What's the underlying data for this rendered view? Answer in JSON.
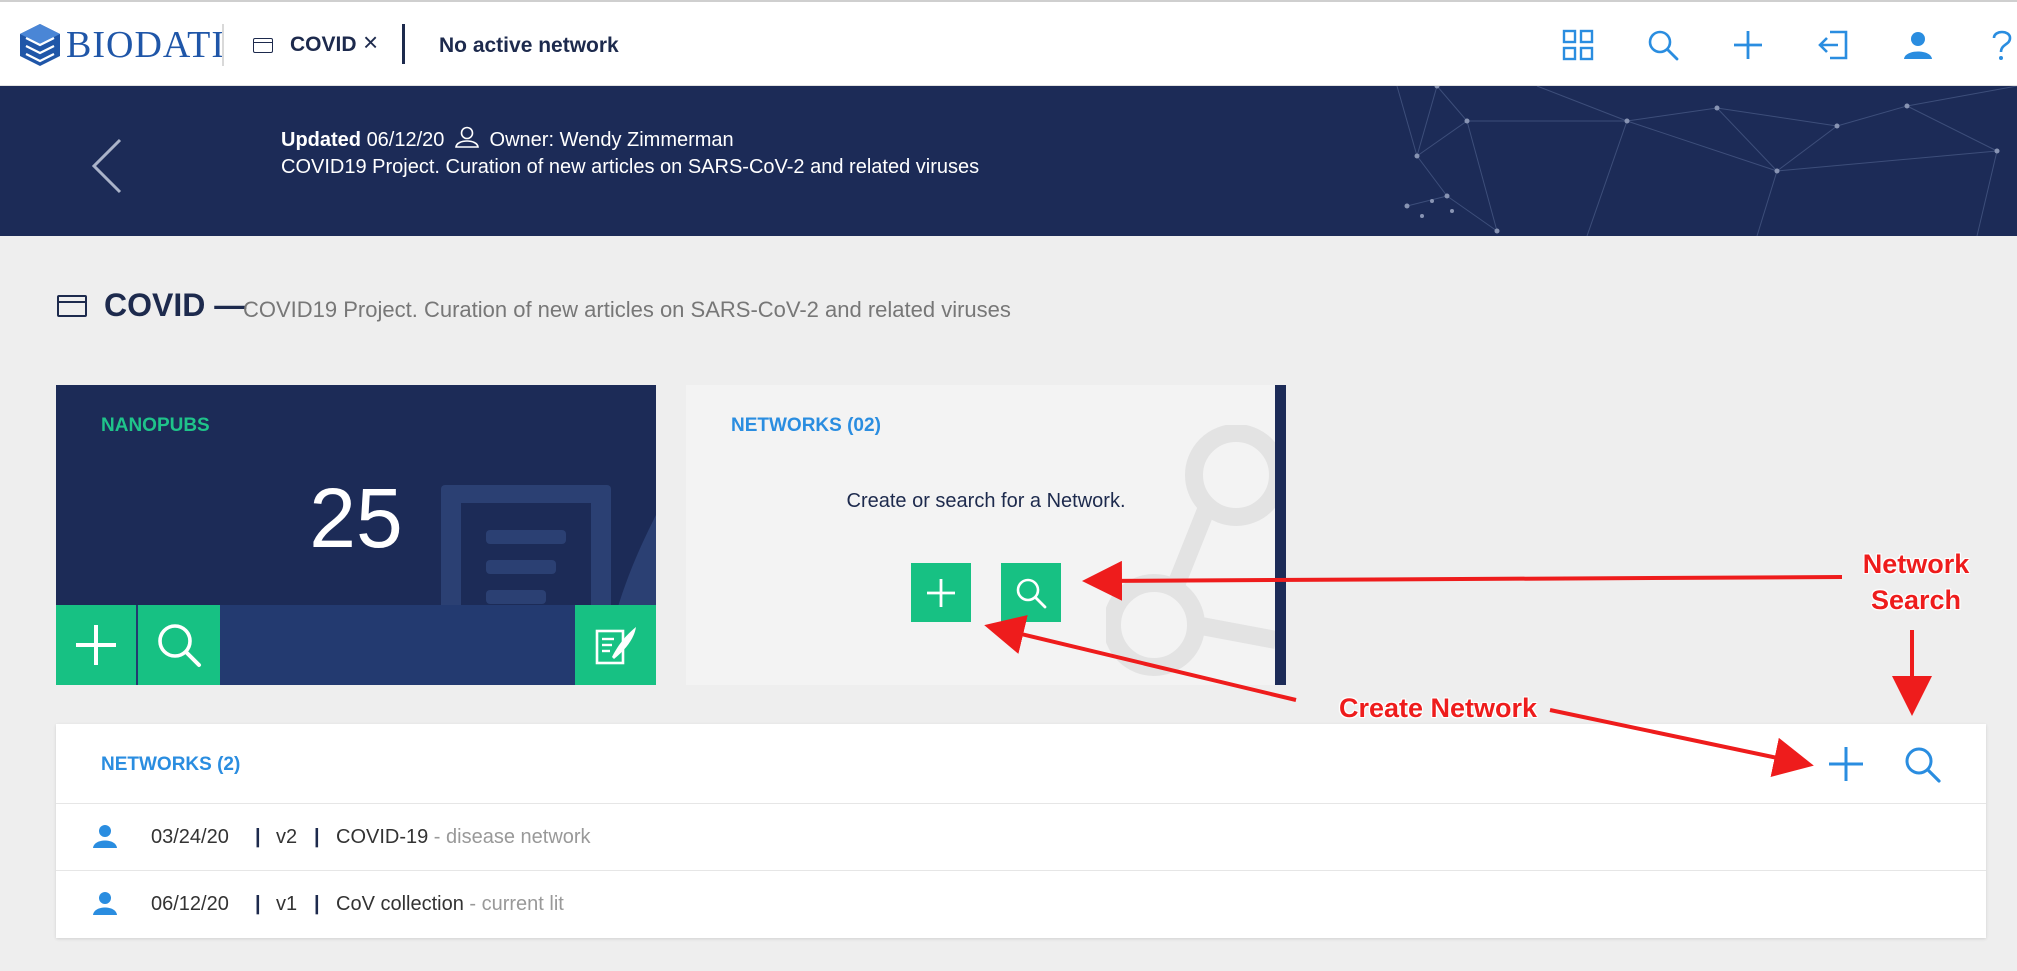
{
  "topbar": {
    "logo_text": "BIODATI",
    "project_name": "COVID",
    "close_glyph": "×",
    "active_network": "No active network",
    "icons": [
      "grid-icon",
      "search-icon",
      "plus-icon",
      "exit-icon",
      "user-icon",
      "help-icon"
    ]
  },
  "header": {
    "updated_label": "Updated",
    "updated_date": "06/12/20",
    "owner_label": "Owner: Wendy Zimmerman",
    "description": "COVID19 Project. Curation of new articles on SARS-CoV-2 and related viruses"
  },
  "page": {
    "title": "COVID",
    "title_dash": "—",
    "description": "COVID19 Project. Curation of new articles on SARS-CoV-2 and related viruses"
  },
  "nanopubs_card": {
    "label": "NANOPUBS",
    "count": "25"
  },
  "networks_card": {
    "label": "NETWORKS (02)",
    "prompt": "Create or search for a Network."
  },
  "networks_list": {
    "title": "NETWORKS (2)",
    "separator": "|",
    "rows": [
      {
        "date": "03/24/20",
        "version": "v2",
        "name": "COVID-19",
        "desc": " - disease network"
      },
      {
        "date": "06/12/20",
        "version": "v1",
        "name": "CoV collection",
        "desc": " - current lit"
      }
    ]
  },
  "annotations": {
    "network_search_line1": "Network",
    "network_search_line2": "Search",
    "create_network": "Create Network"
  },
  "colors": {
    "navy": "#1c2b57",
    "green": "#17c183",
    "blue": "#2a8de0",
    "annotation_red": "#ee1c1c"
  }
}
